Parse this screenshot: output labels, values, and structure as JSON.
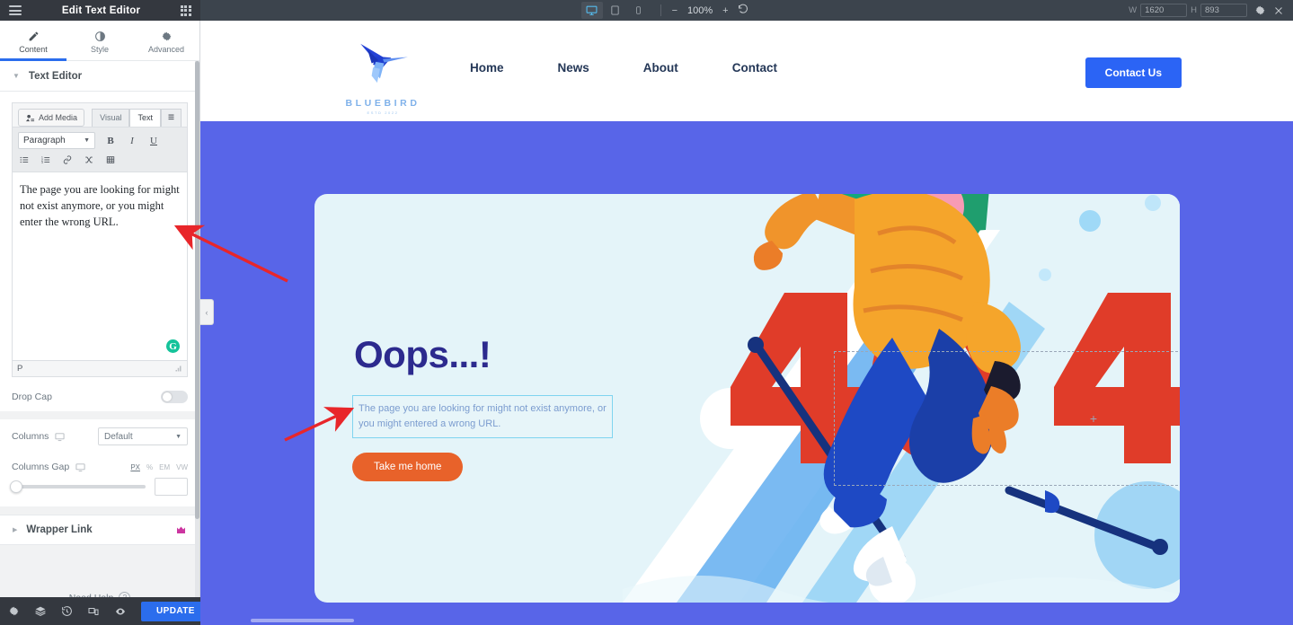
{
  "topbar": {
    "menu_icon": "hamburger-icon",
    "title": "Edit Text Editor",
    "apps_icon": "grid-apps-icon",
    "devices": [
      {
        "name": "desktop",
        "icon": "desktop-icon",
        "active": true
      },
      {
        "name": "tablet",
        "icon": "tablet-icon",
        "active": false
      },
      {
        "name": "mobile",
        "icon": "mobile-icon",
        "active": false
      }
    ],
    "zoom_out": "−",
    "zoom_value": "100%",
    "zoom_in": "+",
    "reset_icon": "reset-rotate-icon",
    "width_label": "W",
    "width_value": "1620",
    "height_label": "H",
    "height_value": "893",
    "settings_icon": "gear-icon",
    "close_icon": "close-icon"
  },
  "panel": {
    "tabs": [
      {
        "label": "Content",
        "icon": "pencil-icon",
        "active": true
      },
      {
        "label": "Style",
        "icon": "contrast-circle-icon",
        "active": false
      },
      {
        "label": "Advanced",
        "icon": "gear-icon",
        "active": false
      }
    ],
    "section": {
      "title": "Text Editor"
    },
    "editor": {
      "add_media": "Add Media",
      "add_media_icon": "media-icon",
      "mode_visual": "Visual",
      "mode_text": "Text",
      "mode_text_active": true,
      "collapse_icon": "collapse-toolbar-icon",
      "format_select": "Paragraph",
      "bold": "B",
      "italic": "I",
      "underline": "U",
      "tools_row2": [
        "bullet-list-icon",
        "numbered-list-icon",
        "link-icon",
        "shuffle-icon",
        "table-icon"
      ],
      "content": "The page you are looking for might not exist anymore, or you might enter the wrong URL.",
      "grammarly_badge": "G",
      "path_status": "P",
      "resize_icon": "resize-grip-icon"
    },
    "drop_cap": {
      "label": "Drop Cap",
      "enabled": false
    },
    "columns": {
      "label": "Columns",
      "device_icon": "desktop-icon",
      "value": "Default",
      "caret_icon": "chevron-down-icon"
    },
    "columns_gap": {
      "label": "Columns Gap",
      "device_icon": "desktop-icon",
      "units": [
        "PX",
        "%",
        "EM",
        "VW"
      ],
      "active_unit": "PX",
      "value": ""
    },
    "wrapper_link": {
      "label": "Wrapper Link",
      "badge_icon": "pro-crown-icon"
    },
    "need_help": {
      "label": "Need Help",
      "icon": "question-mark-icon"
    },
    "footer": {
      "icons": [
        "settings-gear-icon",
        "navigator-layers-icon",
        "history-icon",
        "responsive-preview-icon",
        "preview-eye-icon"
      ],
      "update_label": "UPDATE",
      "update_caret_icon": "chevron-up-icon"
    },
    "collapse_handle_icon": "chevron-left-icon"
  },
  "canvas": {
    "site": {
      "logo": {
        "name": "BLUEBIRD",
        "established": "ESTD 2022",
        "icon": "hummingbird-logo-icon"
      },
      "nav": [
        "Home",
        "News",
        "About",
        "Contact"
      ],
      "cta": "Contact Us"
    },
    "hero": {
      "heading": "Oops...!",
      "paragraph": "The page you are looking for might not exist anymore, or you might entered a wrong URL.",
      "button": "Take me home",
      "illustration": "skier-404-illustration",
      "error_code": "404",
      "add_widget_icon": "plus-icon"
    }
  },
  "colors": {
    "accent_blue": "#2b6ded",
    "page_bg": "#5865e8",
    "card_bg": "#e4f4f9",
    "heading": "#2c2a8e",
    "cta_orange": "#e8622a",
    "error_red": "#e03c29",
    "annotation_red": "#e8262a",
    "topbar": "#3c444d"
  }
}
